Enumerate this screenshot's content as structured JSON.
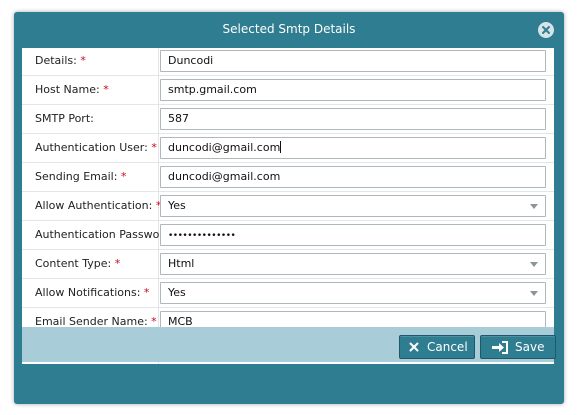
{
  "dialog": {
    "title": "Selected Smtp Details",
    "close_icon": "close-icon"
  },
  "form": {
    "required_marker": "*",
    "fields": [
      {
        "label": "Details:",
        "required": true,
        "type": "text",
        "value": "Duncodi"
      },
      {
        "label": "Host Name:",
        "required": true,
        "type": "text",
        "value": "smtp.gmail.com"
      },
      {
        "label": "SMTP Port:",
        "required": false,
        "type": "text",
        "value": "587"
      },
      {
        "label": "Authentication User:",
        "required": true,
        "type": "text",
        "value": "duncodi@gmail.com"
      },
      {
        "label": "Sending Email:",
        "required": true,
        "type": "text",
        "value": "duncodi@gmail.com"
      },
      {
        "label": "Allow Authentication:",
        "required": true,
        "type": "select",
        "value": "Yes"
      },
      {
        "label": "Authentication Password:",
        "required": false,
        "type": "password",
        "value": "••••••••••••••"
      },
      {
        "label": "Content Type:",
        "required": true,
        "type": "select",
        "value": "Html"
      },
      {
        "label": "Allow Notifications:",
        "required": true,
        "type": "select",
        "value": "Yes"
      },
      {
        "label": "Email Sender Name:",
        "required": true,
        "type": "text",
        "value": "MCB"
      }
    ]
  },
  "footer": {
    "cancel_label": "Cancel",
    "cancel_icon": "x-icon",
    "save_label": "Save",
    "save_icon": "sign-in-icon"
  },
  "colors": {
    "header": "#2f7d90",
    "footer": "#a8cdd8",
    "required": "#d0021b",
    "button": "#2f7d90"
  }
}
